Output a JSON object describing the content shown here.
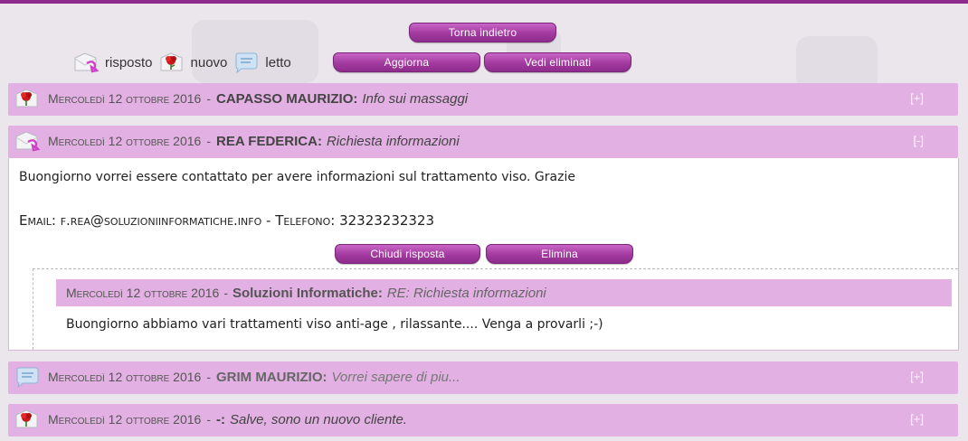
{
  "toolbar": {
    "back_label": "Torna indietro",
    "refresh_label": "Aggiorna",
    "deleted_label": "Vedi eliminati"
  },
  "legend": {
    "replied": "risposto",
    "new": "nuovo",
    "read": "letto"
  },
  "messages": [
    {
      "status_icon": "new-flower-icon",
      "date": "Mercoledì 12 ottobre 2016",
      "sender": "CAPASSO MAURIZIO:",
      "subject": "Info sui massaggi",
      "toggle": "[+]"
    },
    {
      "status_icon": "replied-envelope-icon",
      "date": "Mercoledì 12 ottobre 2016",
      "sender": "REA FEDERICA:",
      "subject": "Richiesta informazioni",
      "toggle": "[-]",
      "body": "Buongiorno vorrei essere contattato per avere informazioni sul trattamento viso. Grazie",
      "contact": "Email: f.rea@soluzioniinformatiche.info - Telefono: 32323232323",
      "close_reply_label": "Chiudi risposta",
      "delete_label": "Elimina",
      "reply": {
        "date": "Mercoledì 12 ottobre 2016",
        "sender": "Soluzioni Informatiche:",
        "subject": "RE: Richiesta informazioni",
        "body": "Buongiorno abbiamo vari trattamenti viso anti-age , rilassante.... Venga a provarli ;-)"
      }
    },
    {
      "status_icon": "read-bubble-icon",
      "date": "Mercoledì 12 ottobre 2016",
      "sender": "GRIM MAURIZIO:",
      "subject": "Vorrei sapere di piu...",
      "toggle": "[+]"
    },
    {
      "status_icon": "new-flower-icon",
      "date": "Mercoledì 12 ottobre 2016",
      "sender": "-:",
      "subject": "Salve, sono un nuovo cliente.",
      "toggle": "[+]"
    }
  ],
  "separator": "-",
  "colors": {
    "accent": "#8e2a8e",
    "row_bg": "#e2b0e2",
    "button": "#a23a9f"
  }
}
